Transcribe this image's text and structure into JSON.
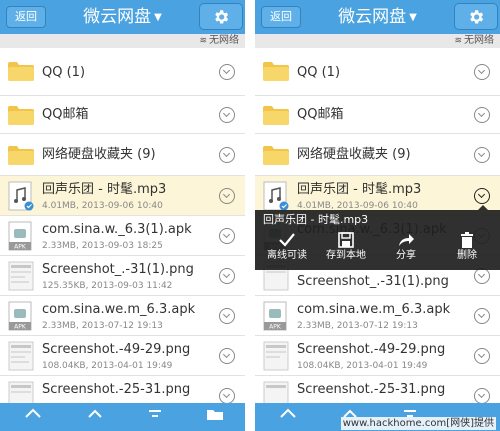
{
  "header": {
    "back_label": "返回",
    "title": "微云网盘",
    "settings_icon": "gear-icon"
  },
  "status": {
    "network": "无网络"
  },
  "folders": [
    {
      "name": "QQ (1)"
    },
    {
      "name": "QQ邮箱"
    },
    {
      "name": "网络硬盘收藏夹 (9)"
    }
  ],
  "files": [
    {
      "name": "回声乐团 - 时髦.mp3",
      "meta": "4.01MB, 2013-09-06 10:40",
      "kind": "music"
    },
    {
      "name": "com.sina.w._6.3(1).apk",
      "meta": "2.33MB, 2013-09-03 18:25",
      "kind": "apk"
    },
    {
      "name": "Screenshot_.-31(1).png",
      "meta": "125.35KB, 2013-09-03 11:42",
      "kind": "image"
    },
    {
      "name": "com.sina.we.m_6.3.apk",
      "meta": "2.33MB, 2013-07-12 19:13",
      "kind": "apk"
    },
    {
      "name": "Screenshot.-49-29.png",
      "meta": "108.04KB, 2013-04-01 19:49",
      "kind": "image"
    },
    {
      "name": "Screenshot.-25-31.png",
      "meta": "",
      "kind": "image"
    }
  ],
  "popup": {
    "title": "回声乐团 - 时髦.mp3",
    "actions": [
      {
        "label": "离线可读",
        "icon": "check-icon"
      },
      {
        "label": "存到本地",
        "icon": "save-icon"
      },
      {
        "label": "分享",
        "icon": "share-icon"
      },
      {
        "label": "删除",
        "icon": "trash-icon"
      }
    ]
  },
  "watermark": "www.hackhome.com[网侠]提供",
  "colors": {
    "header": "#4aa3e0",
    "highlight": "#fcf5d8",
    "popup": "#1e1e1e"
  }
}
